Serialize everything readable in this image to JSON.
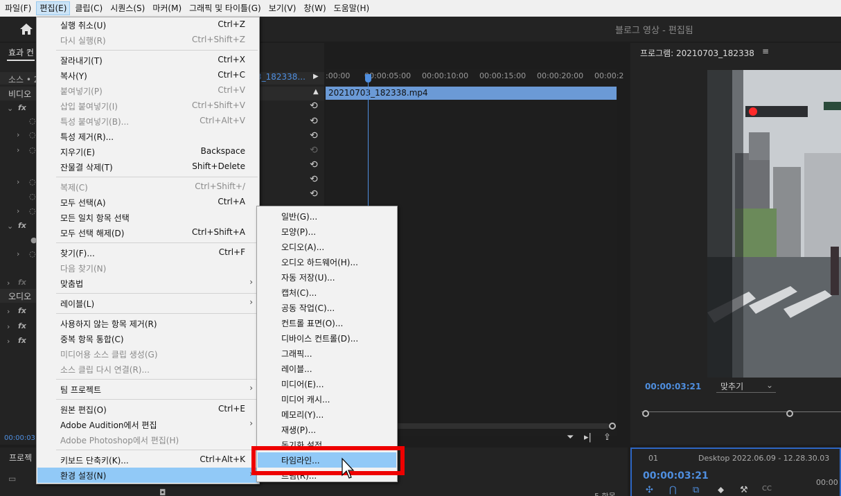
{
  "menubar": {
    "items": [
      {
        "label": "파일(F)"
      },
      {
        "label": "편집(E)"
      },
      {
        "label": "클립(C)"
      },
      {
        "label": "시퀀스(S)"
      },
      {
        "label": "마커(M)"
      },
      {
        "label": "그래픽 및 타이틀(G)"
      },
      {
        "label": "보기(V)"
      },
      {
        "label": "창(W)"
      },
      {
        "label": "도움말(H)"
      }
    ]
  },
  "header": {
    "title": "블로그 영상 - 편집됨"
  },
  "effects_panel": {
    "tab_label": "효과 컨",
    "source_label": "소스 • 2",
    "clip_tab": "3_182338...",
    "video_label": "비디오",
    "audio_label": "오디오",
    "clip_name": "20210703_182338.mp4",
    "ruler": [
      ":00:00",
      "00:00:05:00",
      "00:00:10:00",
      "00:00:15:00",
      "00:00:20:00",
      "00:00:2"
    ],
    "timecode": "00:00:03:"
  },
  "project_panel": {
    "label": "프로젝",
    "item_count": "5 항목"
  },
  "program_monitor": {
    "title": "프로그램: 20210703_182338",
    "timecode": "00:00:03:21",
    "fit": "맞추기"
  },
  "sequence_panel": {
    "number": "01",
    "name": "Desktop 2022.06.09 - 12.28.30.03",
    "timecode": "00:00:03:21",
    "ruler": "00:00"
  },
  "edit_menu": {
    "items": [
      {
        "label": "실행 취소(U)",
        "shortcut": "Ctrl+Z"
      },
      {
        "label": "다시 실행(R)",
        "shortcut": "Ctrl+Shift+Z"
      },
      {
        "label": "잘라내기(T)",
        "shortcut": "Ctrl+X"
      },
      {
        "label": "복사(Y)",
        "shortcut": "Ctrl+C"
      },
      {
        "label": "붙여넣기(P)",
        "shortcut": "Ctrl+V"
      },
      {
        "label": "삽입 붙여넣기(I)",
        "shortcut": "Ctrl+Shift+V"
      },
      {
        "label": "특성 붙여넣기(B)...",
        "shortcut": "Ctrl+Alt+V"
      },
      {
        "label": "특성 제거(R)...",
        "shortcut": ""
      },
      {
        "label": "지우기(E)",
        "shortcut": "Backspace"
      },
      {
        "label": "잔물결 삭제(T)",
        "shortcut": "Shift+Delete"
      },
      {
        "label": "복제(C)",
        "shortcut": "Ctrl+Shift+/"
      },
      {
        "label": "모두 선택(A)",
        "shortcut": "Ctrl+A"
      },
      {
        "label": "모든 일치 항목 선택",
        "shortcut": ""
      },
      {
        "label": "모두 선택 해제(D)",
        "shortcut": "Ctrl+Shift+A"
      },
      {
        "label": "찾기(F)...",
        "shortcut": "Ctrl+F"
      },
      {
        "label": "다음 찾기(N)",
        "shortcut": ""
      },
      {
        "label": "맞춤법",
        "shortcut": ""
      },
      {
        "label": "레이블(L)",
        "shortcut": ""
      },
      {
        "label": "사용하지 않는 항목 제거(R)",
        "shortcut": ""
      },
      {
        "label": "중복 항목 통합(C)",
        "shortcut": ""
      },
      {
        "label": "미디어용 소스 클립 생성(G)",
        "shortcut": ""
      },
      {
        "label": "소스 클립 다시 연결(R)...",
        "shortcut": ""
      },
      {
        "label": "팀 프로젝트",
        "shortcut": ""
      },
      {
        "label": "원본 편집(O)",
        "shortcut": "Ctrl+E"
      },
      {
        "label": "Adobe Audition에서 편집",
        "shortcut": ""
      },
      {
        "label": "Adobe Photoshop에서 편집(H)",
        "shortcut": ""
      },
      {
        "label": "키보드 단축키(K)...",
        "shortcut": "Ctrl+Alt+K"
      },
      {
        "label": "환경 설정(N)",
        "shortcut": ""
      }
    ]
  },
  "preferences_submenu": {
    "items": [
      {
        "label": "일반(G)..."
      },
      {
        "label": "모양(P)..."
      },
      {
        "label": "오디오(A)..."
      },
      {
        "label": "오디오 하드웨어(H)..."
      },
      {
        "label": "자동 저장(U)..."
      },
      {
        "label": "캡처(C)..."
      },
      {
        "label": "공동 작업(C)..."
      },
      {
        "label": "컨트롤 표면(O)..."
      },
      {
        "label": "디바이스 컨트롤(D)..."
      },
      {
        "label": "그래픽..."
      },
      {
        "label": "레이블..."
      },
      {
        "label": "미디어(E)..."
      },
      {
        "label": "미디어 캐시..."
      },
      {
        "label": "메모리(Y)..."
      },
      {
        "label": "재생(P)..."
      },
      {
        "label": "동기화 설정"
      },
      {
        "label": "타임라인..."
      },
      {
        "label": "트림(R)..."
      }
    ]
  },
  "colors": {
    "accent": "#4f8fe0",
    "highlight": "#91c9f7",
    "callout": "#ee0000"
  }
}
